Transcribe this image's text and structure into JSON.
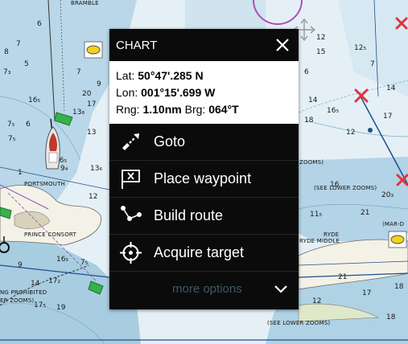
{
  "chart": {
    "labels": {
      "bramble": "BRAMBLE",
      "portsmouth": "PORTSMOUTH",
      "prince_consort": "PRINCE CONSORT",
      "ryde": "RYDE",
      "ryde_middle": "RYDE MIDDLE",
      "mar_de": "(MAR-D",
      "zooms_right": "ZOOMS)",
      "see_lower_zooms_1": "(SEE LOWER ZOOMS)",
      "see_lower_zooms_2": "(SEE LOWER ZOOMS)",
      "prohibited": "NG PROHIBITED",
      "er_zooms": "ER ZOOMS)"
    },
    "depths": [
      "8",
      "7₃",
      "5",
      "16₅",
      "7",
      "20",
      "17",
      "13₈",
      "6",
      "16₅",
      "9₄",
      "7₅",
      "1",
      "12",
      "16₅",
      "17₂",
      "9",
      "7₅",
      "14",
      "17₅",
      "19",
      "12",
      "12₅",
      "15",
      "7",
      "14",
      "6",
      "14",
      "18",
      "16₅",
      "17",
      "12",
      "16",
      "21",
      "17",
      "18",
      "20₃",
      "21",
      "11₅",
      "12",
      "18",
      "6",
      "7",
      "7₅",
      "13",
      "13₆",
      "9"
    ]
  },
  "popup": {
    "title": "CHART",
    "lat_label": "Lat:",
    "lat_value": "50°47'.285 N",
    "lon_label": "Lon:",
    "lon_value": "001°15'.699 W",
    "rng_label": "Rng:",
    "rng_value": "1.10nm",
    "brg_label": "Brg:",
    "brg_value": "064°T",
    "menu": [
      {
        "label": "Goto",
        "icon": "goto-icon"
      },
      {
        "label": "Place waypoint",
        "icon": "waypoint-flag-icon"
      },
      {
        "label": "Build route",
        "icon": "route-icon"
      },
      {
        "label": "Acquire target",
        "icon": "target-crosshair-icon"
      }
    ],
    "more_options": "more options"
  },
  "colors": {
    "land": "#f4f1e7",
    "shallow": "#aecfe2",
    "deep": "#e7f1f7",
    "popup_bg": "#0b0b0b",
    "more_text": "#3f5a66",
    "route": "#1f4e8c",
    "waypoint": "#e0343c"
  }
}
